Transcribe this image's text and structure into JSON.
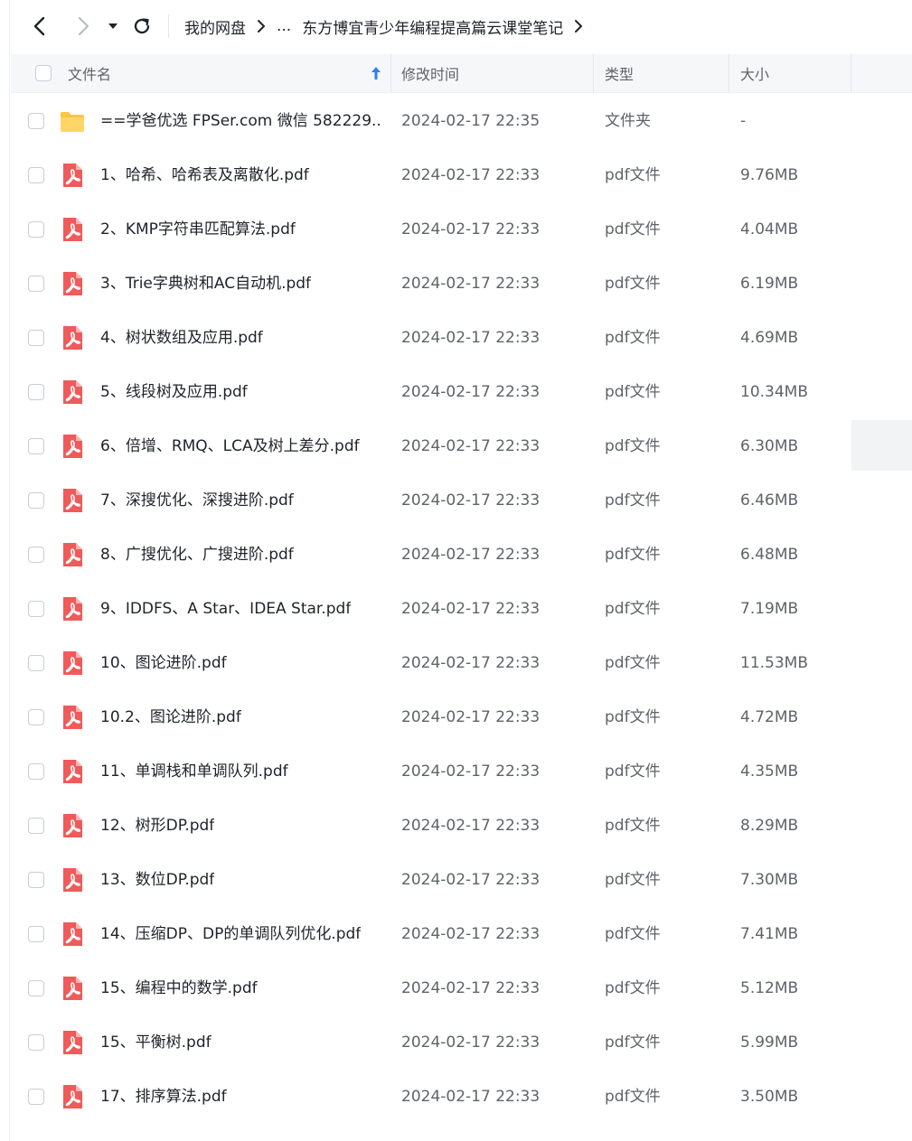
{
  "toolbar": {
    "breadcrumb_root": "我的网盘",
    "breadcrumb_ellipsis": "...",
    "breadcrumb_current": "东方博宜青少年编程提高篇云课堂笔记"
  },
  "columns": {
    "name": "文件名",
    "modified": "修改时间",
    "type": "类型",
    "size": "大小"
  },
  "colors": {
    "accent": "#2d7ff9",
    "pdf_icon": "#f05a5a",
    "folder_icon": "#ffc53d"
  },
  "files": [
    {
      "name": "==学爸优选 FPSer.com 微信 582229...",
      "time": "2024-02-17 22:35",
      "type": "文件夹",
      "size": "-",
      "icon": "folder-icon"
    },
    {
      "name": "1、哈希、哈希表及离散化.pdf",
      "time": "2024-02-17 22:33",
      "type": "pdf文件",
      "size": "9.76MB",
      "icon": "pdf-icon"
    },
    {
      "name": "2、KMP字符串匹配算法.pdf",
      "time": "2024-02-17 22:33",
      "type": "pdf文件",
      "size": "4.04MB",
      "icon": "pdf-icon"
    },
    {
      "name": "3、Trie字典树和AC自动机.pdf",
      "time": "2024-02-17 22:33",
      "type": "pdf文件",
      "size": "6.19MB",
      "icon": "pdf-icon"
    },
    {
      "name": "4、树状数组及应用.pdf",
      "time": "2024-02-17 22:33",
      "type": "pdf文件",
      "size": "4.69MB",
      "icon": "pdf-icon"
    },
    {
      "name": "5、线段树及应用.pdf",
      "time": "2024-02-17 22:33",
      "type": "pdf文件",
      "size": "10.34MB",
      "icon": "pdf-icon"
    },
    {
      "name": "6、倍增、RMQ、LCA及树上差分.pdf",
      "time": "2024-02-17 22:33",
      "type": "pdf文件",
      "size": "6.30MB",
      "icon": "pdf-icon"
    },
    {
      "name": "7、深搜优化、深搜进阶.pdf",
      "time": "2024-02-17 22:33",
      "type": "pdf文件",
      "size": "6.46MB",
      "icon": "pdf-icon"
    },
    {
      "name": "8、广搜优化、广搜进阶.pdf",
      "time": "2024-02-17 22:33",
      "type": "pdf文件",
      "size": "6.48MB",
      "icon": "pdf-icon"
    },
    {
      "name": "9、IDDFS、A Star、IDEA Star.pdf",
      "time": "2024-02-17 22:33",
      "type": "pdf文件",
      "size": "7.19MB",
      "icon": "pdf-icon"
    },
    {
      "name": "10、图论进阶.pdf",
      "time": "2024-02-17 22:33",
      "type": "pdf文件",
      "size": "11.53MB",
      "icon": "pdf-icon"
    },
    {
      "name": "10.2、图论进阶.pdf",
      "time": "2024-02-17 22:33",
      "type": "pdf文件",
      "size": "4.72MB",
      "icon": "pdf-icon"
    },
    {
      "name": "11、单调栈和单调队列.pdf",
      "time": "2024-02-17 22:33",
      "type": "pdf文件",
      "size": "4.35MB",
      "icon": "pdf-icon"
    },
    {
      "name": "12、树形DP.pdf",
      "time": "2024-02-17 22:33",
      "type": "pdf文件",
      "size": "8.29MB",
      "icon": "pdf-icon"
    },
    {
      "name": "13、数位DP.pdf",
      "time": "2024-02-17 22:33",
      "type": "pdf文件",
      "size": "7.30MB",
      "icon": "pdf-icon"
    },
    {
      "name": "14、压缩DP、DP的单调队列优化.pdf",
      "time": "2024-02-17 22:33",
      "type": "pdf文件",
      "size": "7.41MB",
      "icon": "pdf-icon"
    },
    {
      "name": "15、编程中的数学.pdf",
      "time": "2024-02-17 22:33",
      "type": "pdf文件",
      "size": "5.12MB",
      "icon": "pdf-icon"
    },
    {
      "name": "15、平衡树.pdf",
      "time": "2024-02-17 22:33",
      "type": "pdf文件",
      "size": "5.99MB",
      "icon": "pdf-icon"
    },
    {
      "name": "17、排序算法.pdf",
      "time": "2024-02-17 22:33",
      "type": "pdf文件",
      "size": "3.50MB",
      "icon": "pdf-icon"
    }
  ]
}
